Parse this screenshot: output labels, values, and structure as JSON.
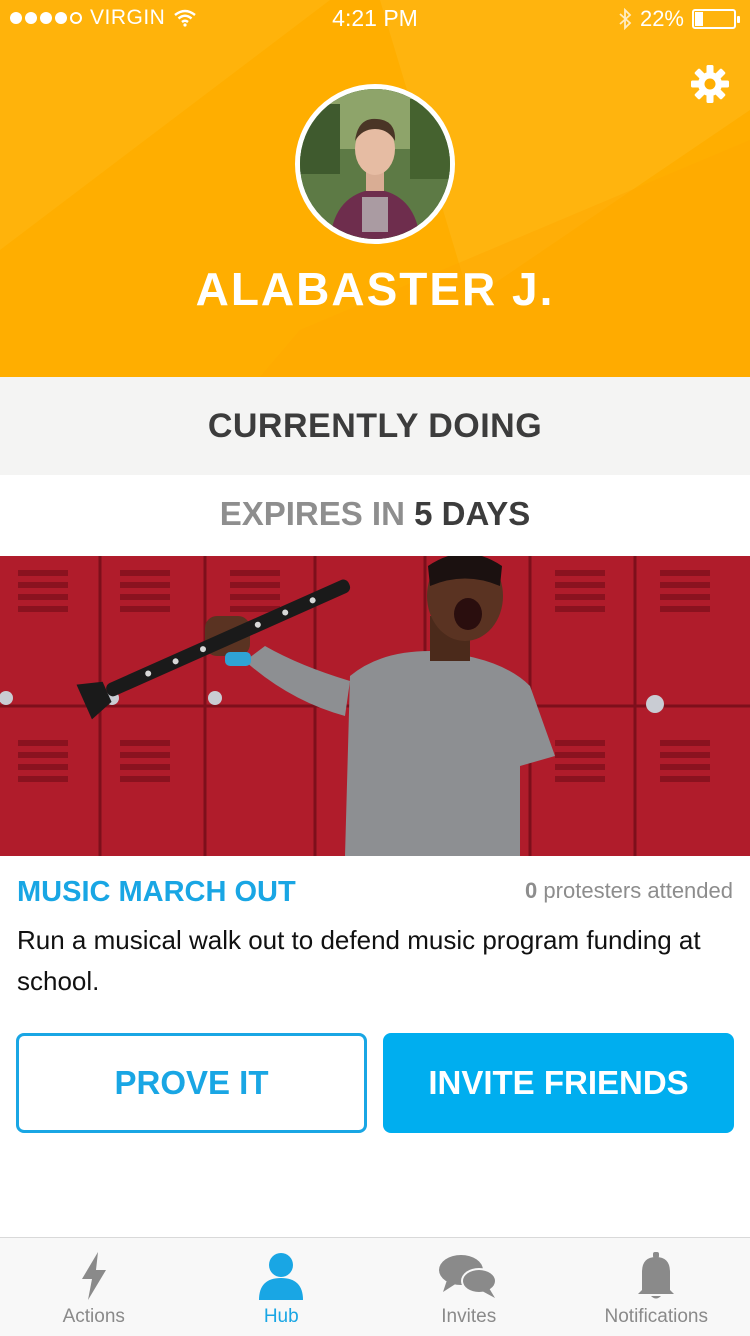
{
  "status_bar": {
    "carrier": "VIRGIN",
    "time": "4:21 PM",
    "battery": "22%",
    "battery_level": 0.22,
    "signal_bars": 4,
    "signal_total": 5
  },
  "profile": {
    "name": "ALABASTER J."
  },
  "section": {
    "currently_doing": "CURRENTLY DOING"
  },
  "expiry": {
    "prefix": "EXPIRES IN",
    "value": "5 DAYS"
  },
  "campaign": {
    "title": "MUSIC MARCH OUT",
    "attended_count": "0",
    "attended_label": "protesters attended",
    "description": "Run a musical walk out to defend music program funding at school."
  },
  "buttons": {
    "prove": "PROVE IT",
    "invite": "INVITE FRIENDS"
  },
  "tabs": [
    {
      "label": "Actions",
      "icon": "lightning-icon",
      "active": false
    },
    {
      "label": "Hub",
      "icon": "person-icon",
      "active": true
    },
    {
      "label": "Invites",
      "icon": "chat-bubbles-icon",
      "active": false
    },
    {
      "label": "Notifications",
      "icon": "bell-icon",
      "active": false
    }
  ],
  "colors": {
    "header": "#ffae00",
    "accent": "#19a6e4",
    "button_fill": "#00aeef"
  }
}
